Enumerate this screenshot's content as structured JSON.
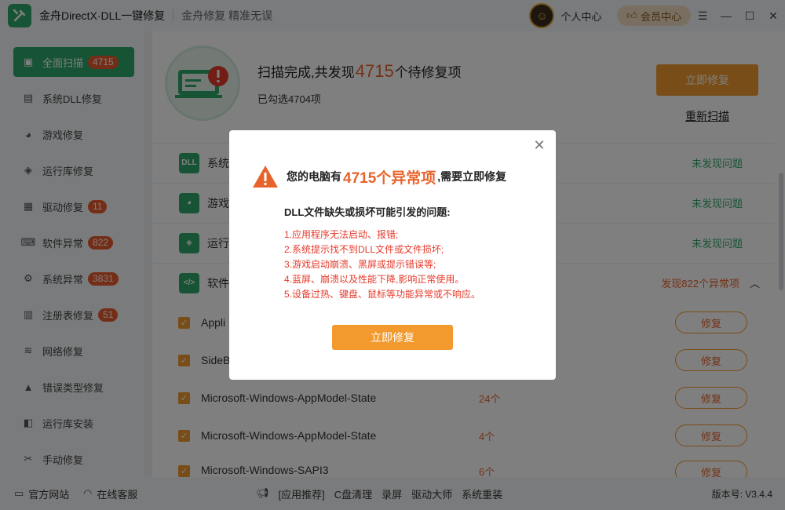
{
  "titlebar": {
    "app_title": "金舟DirectX·DLL一键修复",
    "slogan": "金舟修复 精准无误",
    "personal_center": "个人中心",
    "vip_center": "会员中心"
  },
  "sidebar": {
    "items": [
      {
        "label": "全面扫描",
        "badge": "4715",
        "icon": "scan-icon",
        "active": true
      },
      {
        "label": "系统DLL修复",
        "badge": "",
        "icon": "dll-icon"
      },
      {
        "label": "游戏修复",
        "badge": "",
        "icon": "gamepad-icon"
      },
      {
        "label": "运行库修复",
        "badge": "",
        "icon": "runtime-icon"
      },
      {
        "label": "驱动修复",
        "badge": "11",
        "icon": "driver-icon"
      },
      {
        "label": "软件异常",
        "badge": "822",
        "icon": "code-icon"
      },
      {
        "label": "系统异常",
        "badge": "3831",
        "icon": "gear-icon"
      },
      {
        "label": "注册表修复",
        "badge": "51",
        "icon": "registry-icon"
      },
      {
        "label": "网络修复",
        "badge": "",
        "icon": "wifi-icon"
      },
      {
        "label": "错误类型修复",
        "badge": "",
        "icon": "warning-icon"
      },
      {
        "label": "运行库安装",
        "badge": "",
        "icon": "install-icon"
      },
      {
        "label": "手动修复",
        "badge": "",
        "icon": "wrench-icon"
      }
    ]
  },
  "scan": {
    "title_prefix": "扫描完成,共发现",
    "count": "4715",
    "title_suffix": "个待修复项",
    "selected": "已勾选4704项",
    "fix_button": "立即修复",
    "rescan": "重新扫描"
  },
  "categories": [
    {
      "name": "系统",
      "icon_text": "DLL",
      "status": "未发现问题"
    },
    {
      "name": "游戏",
      "icon_text": "◕",
      "status": "未发现问题"
    },
    {
      "name": "运行",
      "icon_text": "◈",
      "status": "未发现问题"
    },
    {
      "name": "软件",
      "icon_text": "</>",
      "status": "发现822个异常项"
    }
  ],
  "items": [
    {
      "name": "Appli",
      "count": "",
      "button": "修复"
    },
    {
      "name": "SideB",
      "count": "",
      "button": "修复"
    },
    {
      "name": "Microsoft-Windows-AppModel-State",
      "count": "24个",
      "button": "修复"
    },
    {
      "name": "Microsoft-Windows-AppModel-State",
      "count": "4个",
      "button": "修复"
    },
    {
      "name": "Microsoft-Windows-SAPI3",
      "count": "6个",
      "button": "修复"
    }
  ],
  "footer": {
    "official_site": "官方网站",
    "online_service": "在线客服",
    "tools": [
      "[应用推荐]",
      "C盘清理",
      "录屏",
      "驱动大师",
      "系统重装"
    ],
    "version": "版本号: V3.4.4"
  },
  "modal": {
    "head_prefix": "您的电脑有",
    "head_count": "4715个异常项",
    "head_suffix": ",需要立即修复",
    "subtitle": "DLL文件缺失或损坏可能引发的问题:",
    "problems": [
      "1.应用程序无法启动、报错;",
      "2.系统提示找不到DLL文件或文件损坏;",
      "3.游戏启动崩溃、黑屏或提示错误等;",
      "4.蓝屏、崩溃以及性能下降,影响正常使用。",
      "5.设备过热、键盘、鼠标等功能异常或不响应。"
    ],
    "button": "立即修复"
  },
  "colors": {
    "brand_green": "#2fa86a",
    "accent_orange": "#f29a2e",
    "alert_red": "#e53b2c",
    "badge_orange": "#e85a2c"
  }
}
